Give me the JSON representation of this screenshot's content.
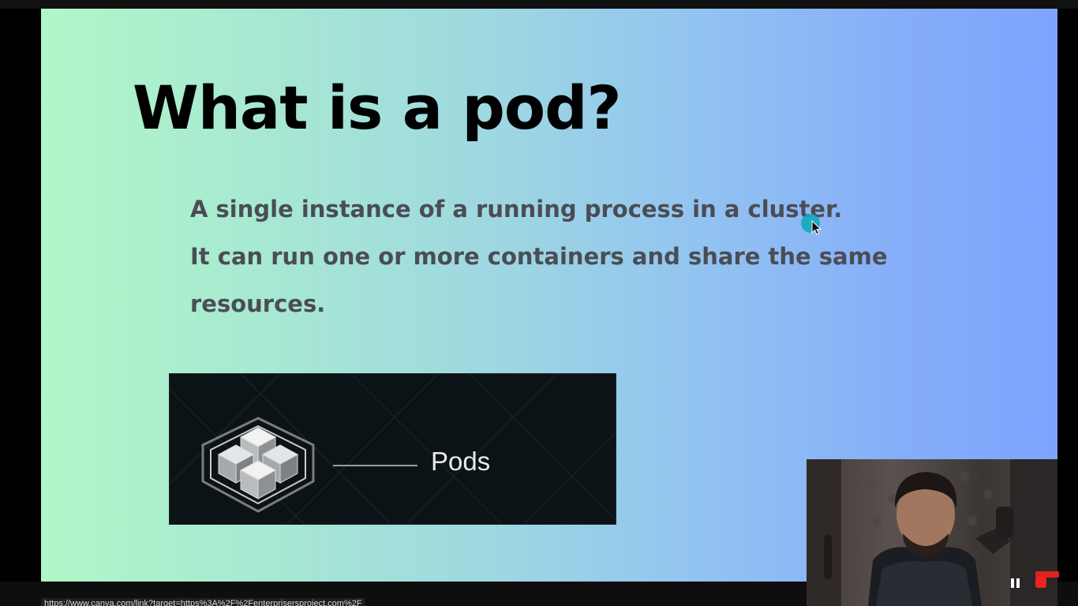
{
  "slide": {
    "title": "What is a pod?",
    "lines": [
      "A single instance of a running process in a cluster.",
      "It can run one or more containers and share the same resources."
    ],
    "graphic_label": "Pods",
    "background_colors": [
      "#b1f7c8",
      "#9ed7e1",
      "#7ea4ff"
    ],
    "title_color": "#000000",
    "text_color": "#4a4d54"
  },
  "graphic": {
    "icon": "hexagon-cubes-icon",
    "background_color": "#0c1316"
  },
  "cursor": {
    "icon": "mouse-pointer-icon",
    "highlight_color": "#12a9bd"
  },
  "status_bar": {
    "url": "https://www.canva.com/link?target=https%3A%2F%2Fenterprisersproject.com%2F"
  },
  "webcam": {
    "icon": "webcam-presenter-icon"
  },
  "recording": {
    "pause_icon": "pause-icon",
    "stop_icon": "stop-icon",
    "stop_color": "#ee2424"
  }
}
